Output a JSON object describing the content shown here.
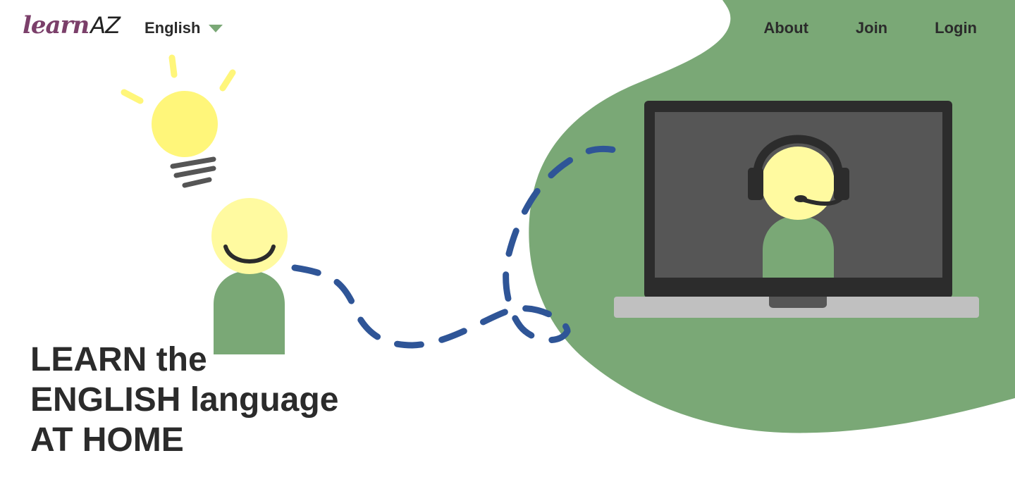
{
  "header": {
    "logo": {
      "main": "learn",
      "accent": "AZ"
    },
    "language": {
      "selected": "English"
    },
    "nav": [
      {
        "label": "About"
      },
      {
        "label": "Join"
      },
      {
        "label": "Login"
      }
    ]
  },
  "hero": {
    "title_lines": [
      "LEARN the",
      "ENGLISH language",
      "AT HOME"
    ]
  },
  "colors": {
    "green": "#7aa876",
    "yellow": "#fffaa0",
    "bulb": "#fff67a",
    "dash": "#2f5597",
    "screen": "#565656",
    "frame": "#2c2c2c",
    "base": "#c0c0c0",
    "logo": "#7b3f6a"
  },
  "icons": [
    "lightbulb-icon",
    "student-icon",
    "teacher-icon",
    "laptop-icon",
    "headset-icon"
  ]
}
